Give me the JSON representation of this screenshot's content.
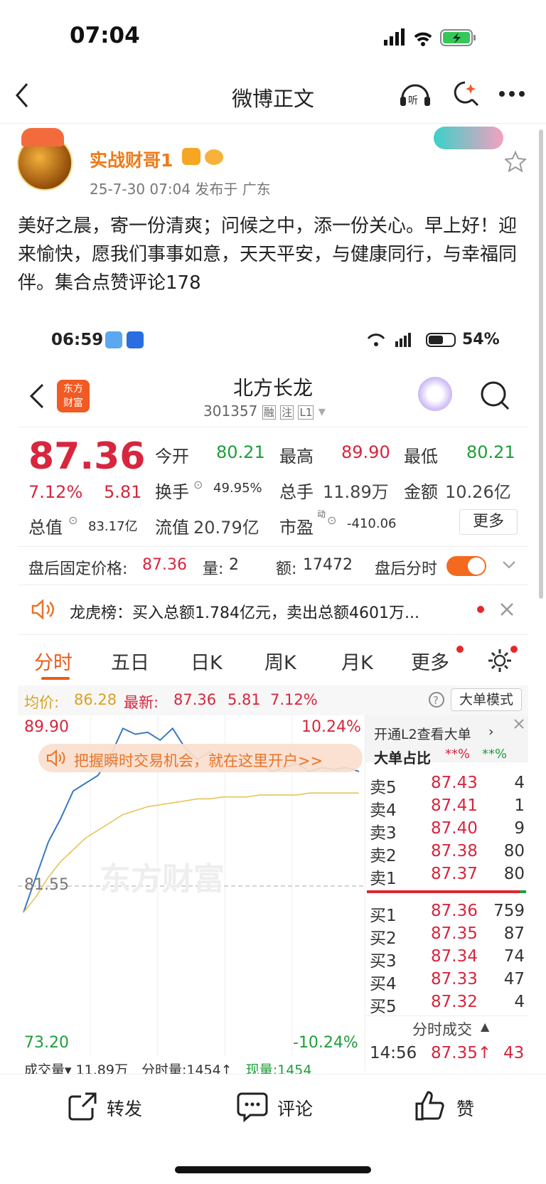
{
  "status": {
    "time": "07:04"
  },
  "nav": {
    "title": "微博正文"
  },
  "post": {
    "username": "实战财哥1",
    "meta": "25-7-30 07:04  发布于 广东",
    "text": "美好之晨，寄一份清爽；问候之中，添一份关心。早上好！迎来愉快，愿我们事事如意，天天平安，与健康同行，与幸福同伴。集合点赞评论178"
  },
  "shot": {
    "time": "06:59",
    "battery": "54%",
    "title": "北方长龙",
    "code": "301357",
    "code_tags": [
      "融",
      "注",
      "L1"
    ],
    "price": "87.36",
    "pct": "7.12%",
    "chg": "5.81",
    "fields": {
      "open_label": "今开",
      "open": "80.21",
      "high_label": "最高",
      "high": "89.90",
      "low_label": "最低",
      "low": "80.21",
      "turnover_label": "换手",
      "turnover": "49.95%",
      "vol_label": "总手",
      "vol": "11.89万",
      "amt_label": "金额",
      "amt": "10.26亿",
      "mcap_label": "总值",
      "mcap": "83.17亿",
      "fcap_label": "流值",
      "fcap": "20.79亿",
      "pe_label": "市盈",
      "pe_sup": "动",
      "pe": "-410.06",
      "more": "更多"
    },
    "after": {
      "label": "盘后固定价格:",
      "price": "87.36",
      "vol_label": "量:",
      "vol": "2",
      "amt_label": "额:",
      "amt": "17472",
      "toggle_label": "盘后分时"
    },
    "notice": "龙虎榜：买入总额1.784亿元，卖出总额4601万...",
    "tabs": [
      "分时",
      "五日",
      "日K",
      "周K",
      "月K",
      "更多"
    ],
    "info_line": {
      "avg_label": "均价:",
      "avg": "86.28",
      "latest_label": "最新:",
      "latest": "87.36",
      "chg": "5.81",
      "pct": "7.12%",
      "mode": "大单模式"
    },
    "chart_labels": {
      "top": "89.90",
      "top_pct": "10.24%",
      "mid": "81.55",
      "bottom": "73.20",
      "bottom_pct": "-10.24%",
      "watermark": "东方财富",
      "banner": "把握瞬时交易机会，就在这里开户>>"
    },
    "bottom_line": {
      "a": "成交量",
      "b": "11.89万",
      "c": "分时量:1454↑",
      "d": "现量:1454"
    },
    "l2": {
      "link": "开通L2查看大单",
      "ratio_label": "大单占比",
      "ratio_red": "**%",
      "ratio_green": "**%"
    },
    "orderbook": {
      "sells": [
        {
          "label": "卖5",
          "price": "87.43",
          "qty": "4"
        },
        {
          "label": "卖4",
          "price": "87.41",
          "qty": "1"
        },
        {
          "label": "卖3",
          "price": "87.40",
          "qty": "9"
        },
        {
          "label": "卖2",
          "price": "87.38",
          "qty": "80"
        },
        {
          "label": "卖1",
          "price": "87.37",
          "qty": "80"
        }
      ],
      "buys": [
        {
          "label": "买1",
          "price": "87.36",
          "qty": "759"
        },
        {
          "label": "买2",
          "price": "87.35",
          "qty": "87"
        },
        {
          "label": "买3",
          "price": "87.34",
          "qty": "74"
        },
        {
          "label": "买4",
          "price": "87.33",
          "qty": "47"
        },
        {
          "label": "买5",
          "price": "87.32",
          "qty": "4"
        }
      ]
    },
    "ticks": {
      "header": "分时成交",
      "rows": [
        {
          "time": "14:56",
          "price": "87.35↑",
          "qty": "43"
        }
      ]
    }
  },
  "chart_data": {
    "type": "line",
    "title": "",
    "ylim": [
      73.2,
      89.9
    ],
    "series": [
      {
        "name": "",
        "values": [
          80.2,
          82.0,
          83.8,
          85.0,
          86.4,
          86.8,
          87.2,
          88.2,
          89.6,
          89.3,
          89.4,
          89.0,
          89.6,
          88.6,
          88.0,
          88.4,
          87.8,
          88.0,
          87.6,
          87.8,
          87.4,
          87.6,
          87.8,
          87.4,
          87.6,
          87.5,
          87.6,
          87.4
        ]
      },
      {
        "name": "",
        "values": [
          80.2,
          81.0,
          82.0,
          82.8,
          83.4,
          84.0,
          84.4,
          84.8,
          85.2,
          85.4,
          85.6,
          85.7,
          85.8,
          85.9,
          86.0,
          86.0,
          86.1,
          86.1,
          86.1,
          86.2,
          86.2,
          86.2,
          86.2,
          86.3,
          86.3,
          86.3,
          86.3,
          86.3
        ]
      }
    ]
  },
  "actions": {
    "repost": "转发",
    "comment": "评论",
    "like": "赞"
  }
}
